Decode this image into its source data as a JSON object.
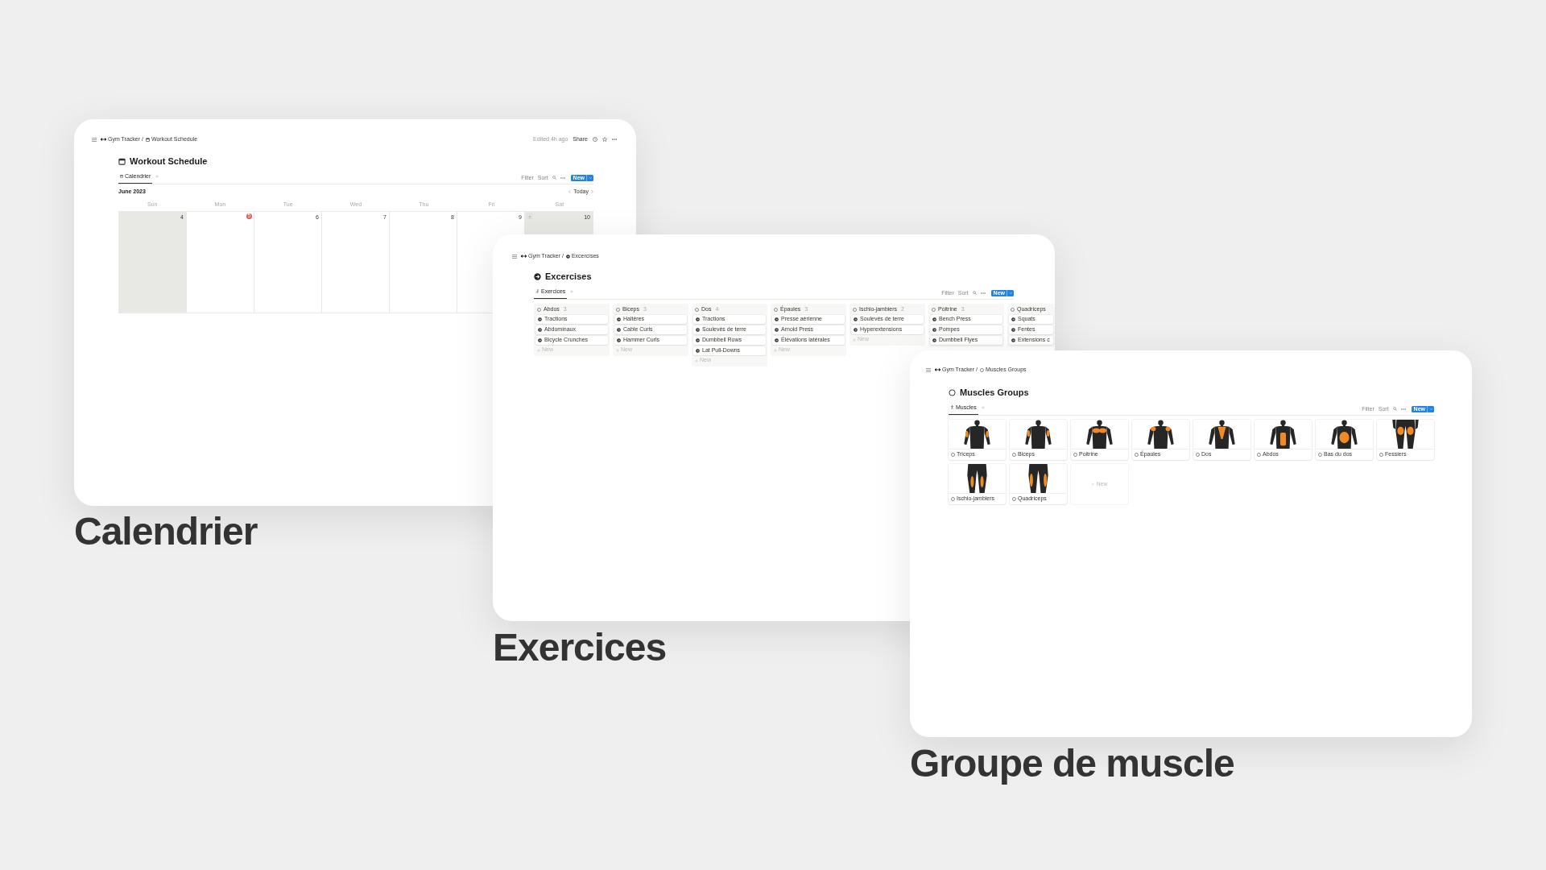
{
  "calendar_window": {
    "breadcrumb": [
      "Gym Tracker /",
      "Workout Schedule"
    ],
    "edited": "Edited 4h ago",
    "share": "Share",
    "title": "Workout Schedule",
    "tabs": [
      {
        "label": "Calendrier",
        "selected": true
      }
    ],
    "toolbar": {
      "filter": "Filter",
      "sort": "Sort",
      "new": "New"
    },
    "month": "June 2023",
    "today": "Today",
    "weekdays": [
      "Sun",
      "Mon",
      "Tue",
      "Wed",
      "Thu",
      "Fri",
      "Sat"
    ],
    "days": [
      {
        "label": "4",
        "today": false,
        "weekend": true
      },
      {
        "label": "5",
        "today": true,
        "weekend": false
      },
      {
        "label": "6",
        "today": false,
        "weekend": false
      },
      {
        "label": "7",
        "today": false,
        "weekend": false
      },
      {
        "label": "8",
        "today": false,
        "weekend": false
      },
      {
        "label": "9",
        "today": false,
        "weekend": false
      },
      {
        "label": "10",
        "today": false,
        "weekend": true
      }
    ]
  },
  "exercises_window": {
    "breadcrumb": [
      "Gym Tracker /",
      "Excercises"
    ],
    "title": "Excercises",
    "tabs": [
      {
        "label": "Exercices",
        "selected": true
      }
    ],
    "toolbar": {
      "filter": "Filter",
      "sort": "Sort",
      "new": "New"
    },
    "columns": [
      {
        "name": "Abdos",
        "count": "3",
        "items": [
          "Tractions",
          "Abdominaux",
          "Bicycle Crunches"
        ],
        "new": "New"
      },
      {
        "name": "Biceps",
        "count": "3",
        "items": [
          "Haltères",
          "Cable Curls",
          "Hammer Curls"
        ],
        "new": "New"
      },
      {
        "name": "Dos",
        "count": "4",
        "items": [
          "Tractions",
          "Soulevés de terre",
          "Dumbbell Rows",
          "Lat Pull-Downs"
        ],
        "new": "New"
      },
      {
        "name": "Épaules",
        "count": "3",
        "items": [
          "Presse aérienne",
          "Arnold Press",
          "Élévations latérales"
        ],
        "new": "New"
      },
      {
        "name": "Ischio-jambiers",
        "count": "2",
        "items": [
          "Soulevés de terre",
          "Hyperextensions"
        ],
        "new": "New"
      },
      {
        "name": "Poitrine",
        "count": "3",
        "items": [
          "Bench Press",
          "Pompes",
          "Dumbbell Flyes"
        ]
      },
      {
        "name": "Quadriceps",
        "items": [
          "Squats",
          "Fentes",
          "Extensions c"
        ]
      }
    ]
  },
  "muscles_window": {
    "breadcrumb": [
      "Gym Tracker /",
      "Muscles Groups"
    ],
    "title": "Muscles Groups",
    "tabs": [
      {
        "label": "Muscles",
        "selected": true
      }
    ],
    "toolbar": {
      "filter": "Filter",
      "sort": "Sort",
      "new": "New"
    },
    "cards": [
      {
        "label": "Triceps"
      },
      {
        "label": "Biceps"
      },
      {
        "label": "Poitrine"
      },
      {
        "label": "Épaules"
      },
      {
        "label": "Dos"
      },
      {
        "label": "Abdos"
      },
      {
        "label": "Bas du dos"
      },
      {
        "label": "Fessiers"
      },
      {
        "label": "Ischio-jambiers"
      },
      {
        "label": "Quadriceps"
      }
    ],
    "new": "New"
  },
  "captions": [
    "Calendrier",
    "Exercices",
    "Groupe de muscle"
  ]
}
